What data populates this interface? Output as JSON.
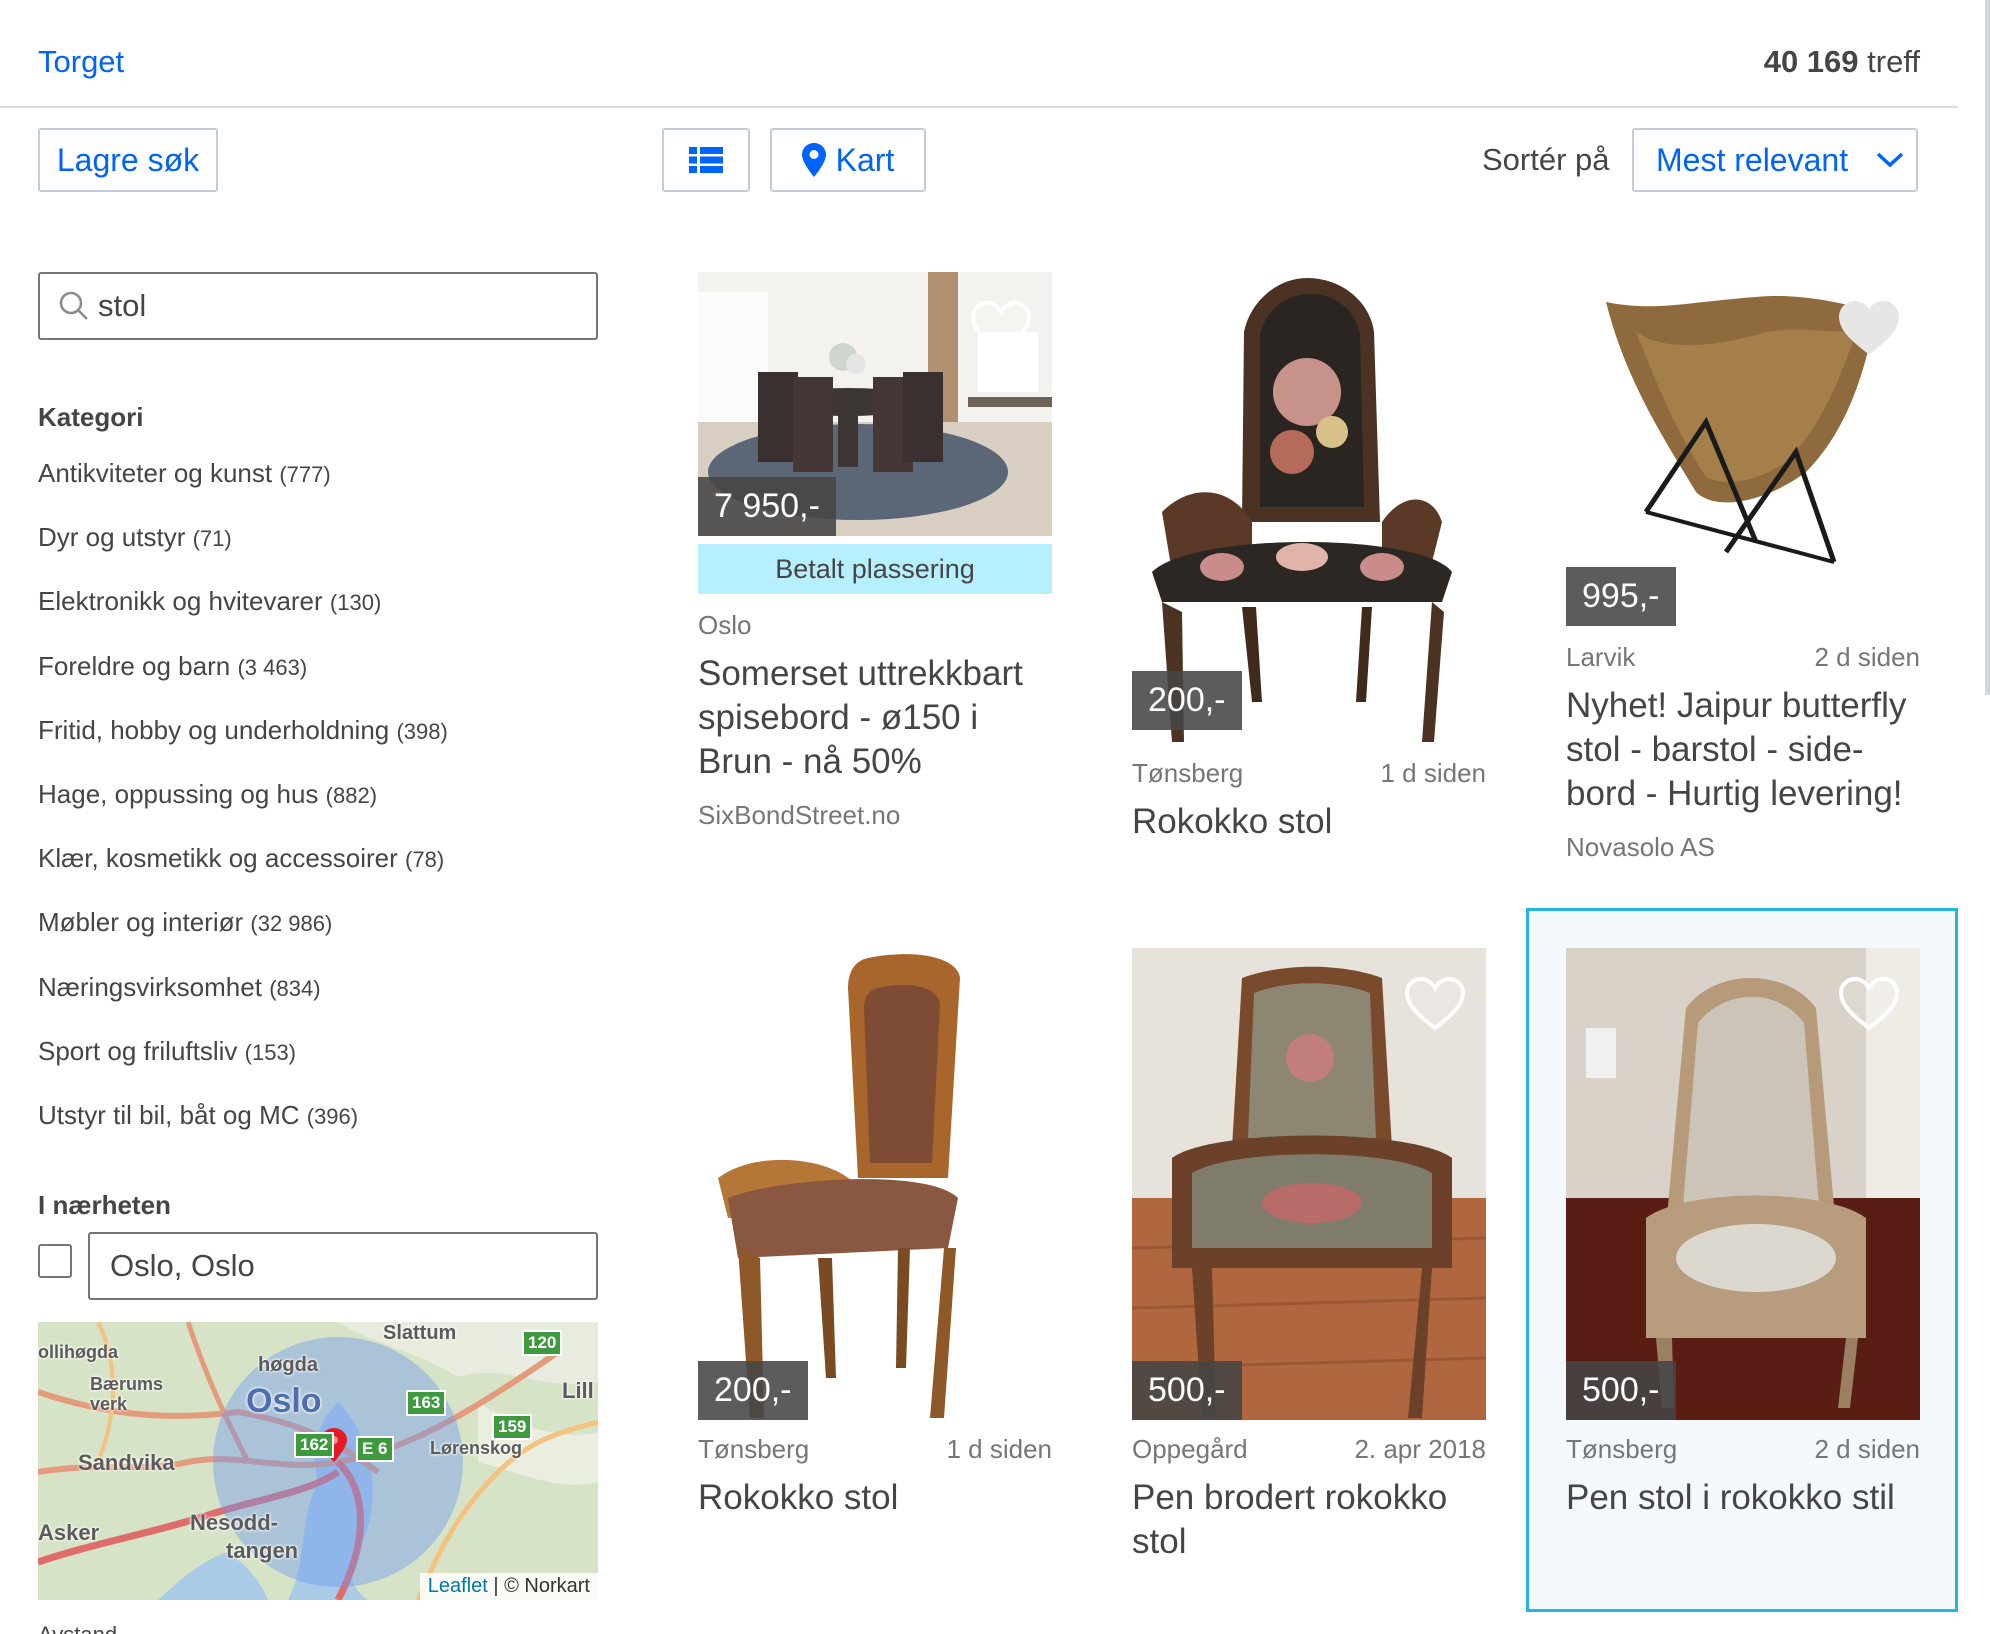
{
  "header": {
    "breadcrumb": "Torget",
    "hits_count": "40 169",
    "hits_label": "treff"
  },
  "toolbar": {
    "save_search": "Lagre søk",
    "map_button": "Kart",
    "sort_label": "Sortér på",
    "sort_value": "Mest relevant"
  },
  "search": {
    "value": "stol"
  },
  "category": {
    "heading": "Kategori",
    "items": [
      {
        "label": "Antikviteter og kunst",
        "count": "(777)"
      },
      {
        "label": "Dyr og utstyr",
        "count": "(71)"
      },
      {
        "label": "Elektronikk og hvitevarer",
        "count": "(130)"
      },
      {
        "label": "Foreldre og barn",
        "count": "(3 463)"
      },
      {
        "label": "Fritid, hobby og underholdning",
        "count": "(398)"
      },
      {
        "label": "Hage, oppussing og hus",
        "count": "(882)"
      },
      {
        "label": "Klær, kosmetikk og accessoirer",
        "count": "(78)"
      },
      {
        "label": "Møbler og interiør",
        "count": "(32 986)"
      },
      {
        "label": "Næringsvirksomhet",
        "count": "(834)"
      },
      {
        "label": "Sport og friluftsliv",
        "count": "(153)"
      },
      {
        "label": "Utstyr til bil, båt og MC",
        "count": "(396)"
      }
    ]
  },
  "nearby": {
    "heading": "I nærheten",
    "location": "Oslo, Oslo",
    "checked": false,
    "map": {
      "place_labels": [
        "ollihøgda",
        "Bærums verk",
        "høgda",
        "Slattum",
        "Oslo",
        "Sandvika",
        "Lørenskog",
        "Nesodd-",
        "tangen",
        "Asker",
        "Lill"
      ],
      "road_shields": [
        "120",
        "163",
        "159",
        "162",
        "E 6"
      ],
      "attribution_link": "Leaflet",
      "attribution_text": "| © Norkart"
    },
    "below_map_text": "Avstand"
  },
  "listings": [
    {
      "price": "7 950,-",
      "badge": "Betalt plassering",
      "location": "Oslo",
      "age": "",
      "title": "Somerset uttrekkbart spisebord - ø150 i Brun - nå 50%",
      "seller": "SixBondStreet.no",
      "favorited": false
    },
    {
      "price": "200,-",
      "badge": "",
      "location": "Tønsberg",
      "age": "1 d siden",
      "title": "Rokokko stol",
      "seller": "",
      "favorited": false
    },
    {
      "price": "995,-",
      "badge": "",
      "location": "Larvik",
      "age": "2 d siden",
      "title": "Nyhet! Jaipur butterfly stol - barstol - side-bord - Hurtig levering!",
      "seller": "Novasolo AS",
      "favorited": false
    },
    {
      "price": "200,-",
      "badge": "",
      "location": "Tønsberg",
      "age": "1 d siden",
      "title": "Rokokko stol",
      "seller": "",
      "favorited": false
    },
    {
      "price": "500,-",
      "badge": "",
      "location": "Oppegård",
      "age": "2. apr 2018",
      "title": "Pen brodert rokokko stol",
      "seller": "",
      "favorited": false
    },
    {
      "price": "500,-",
      "badge": "",
      "location": "Tønsberg",
      "age": "2 d siden",
      "title": "Pen stol i rokokko stil",
      "seller": "",
      "favorited": false
    }
  ],
  "colors": {
    "link_blue": "#0063fb",
    "text": "#474445",
    "muted": "#767676",
    "paid_badge": "#b6f0ff",
    "selected_border": "#26b4e3"
  }
}
